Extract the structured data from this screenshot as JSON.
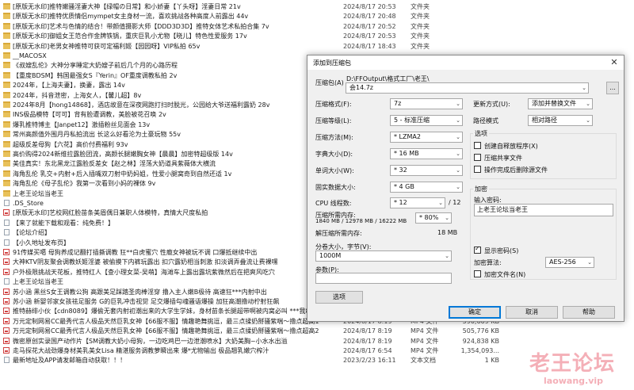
{
  "files": [
    {
      "name": "[原版无水印]推特嫩骚淫妻大神【绿帽の日常】和小娇妻【丫头呀】淫妻日常 21v",
      "date": "2024/8/17 20:53",
      "type": "文件夹",
      "size": "",
      "icon": "folder-icon"
    },
    {
      "name": "[原版无水印]推特优质情侣mympet女主身材一流，喜欢挑战各种高度人前露出 44v",
      "date": "2024/8/17 20:48",
      "type": "文件夹",
      "size": "",
      "icon": "folder-icon"
    },
    {
      "name": "[原版无水印]艺术与色情的结合！带颜值摄影大师【DDD3D3D】推特女体艺术私拍合集 7v",
      "date": "2024/8/17 20:52",
      "type": "文件夹",
      "size": "",
      "icon": "folder-icon"
    },
    {
      "name": "[原版无水印]御姐女王范合作金牌铁锅，重庆巨乳小尤物【晓儿】特色性爱服务 17v",
      "date": "2024/8/17 20:53",
      "type": "文件夹",
      "size": "",
      "icon": "folder-icon"
    },
    {
      "name": "[原版无水印]老男女神推特可获可定福利姬【园园呀】VIP私拍 65v",
      "date": "2024/8/17 18:43",
      "type": "文件夹",
      "size": "",
      "icon": "folder-icon"
    },
    {
      "name": "__MACOSX",
      "date": "",
      "type": "",
      "size": "",
      "icon": "folder-icon"
    },
    {
      "name": "《叔嫂乱伦》大神分享睡定大奶嫂子前后几个月的心路历程",
      "date": "",
      "type": "",
      "size": "",
      "icon": "folder-icon"
    },
    {
      "name": "【重度BDSM】韩国最强女S『Yerin』OF重度调教私拍 2v",
      "date": "",
      "type": "",
      "size": "",
      "icon": "folder-icon"
    },
    {
      "name": "2024年，【上海夫妻】，换妻，露出 14v",
      "date": "",
      "type": "",
      "size": "",
      "icon": "folder-icon"
    },
    {
      "name": "2024年，抖音泄密，上海女人，【馨儿超】8v",
      "date": "",
      "type": "",
      "size": "",
      "icon": "folder-icon"
    },
    {
      "name": "2024年8月【hong14868】，酒店故意在深夜网跑打扫时脱光，公园给大爷送福利露奶 28v",
      "date": "",
      "type": "",
      "size": "",
      "icon": "folder-icon"
    },
    {
      "name": "INS极品模特【可可】背有脸遭调教，美脸被花召唤 2v",
      "date": "",
      "type": "",
      "size": "",
      "icon": "folder-icon"
    },
    {
      "name": "爆乳推特博主【Janpet12】激插粉丝见面会 13v",
      "date": "",
      "type": "",
      "size": "",
      "icon": "folder-icon"
    },
    {
      "name": "常州高颜值外围月丹私拍流出 长这么好看沦为土豪玩物 55v",
      "date": "",
      "type": "",
      "size": "",
      "icon": "folder-icon"
    },
    {
      "name": "超级反差母狗【六花】高价付费福利 93v",
      "date": "",
      "type": "",
      "size": "",
      "icon": "folder-icon"
    },
    {
      "name": "高价购得2024新维拉露脸团流，高颜长腿嫩胸女神【晨晨】加密特超级版 14v",
      "date": "",
      "type": "",
      "size": "",
      "icon": "folder-icon"
    },
    {
      "name": "美佳真实！东北黑龙江露脸反差女【赵之林】淫荡大奶道具紫薇体大横流",
      "date": "",
      "type": "",
      "size": "",
      "icon": "folder-icon"
    },
    {
      "name": "海角乱伦 乳交+内射+后入插嘴双刀射中奶妈姐，性爱小腿窝奇到自然还适 1v",
      "date": "",
      "type": "",
      "size": "",
      "icon": "folder-icon"
    },
    {
      "name": "海角乱伦《母子乱伦》我第一次看到小妈的裸体 9v",
      "date": "",
      "type": "",
      "size": "",
      "icon": "folder-icon"
    },
    {
      "name": "上老王论坛当老王",
      "date": "",
      "type": "",
      "size": "",
      "icon": "folder-icon"
    },
    {
      "name": ".DS_Store",
      "date": "",
      "type": "",
      "size": "",
      "icon": "file-icon"
    },
    {
      "name": "[原版无水印]艺校网红脸苗条美眉偶日兼职人体模特，真情大尺度私拍",
      "date": "",
      "type": "",
      "size": "",
      "icon": "image-icon"
    },
    {
      "name": "【来了就能下载和观看：纯免费！】",
      "date": "",
      "type": "",
      "size": "",
      "icon": "file-icon"
    },
    {
      "name": "【论坛介绍】",
      "date": "",
      "type": "",
      "size": "",
      "icon": "file-icon"
    },
    {
      "name": "【小久地址发布页】",
      "date": "",
      "type": "",
      "size": "",
      "icon": "file-icon"
    },
    {
      "name": "91传媒买噶 母狗养成记翻打插撕调教 狂**白虎蜜穴 性瘾女神被玩不调 口爆抵继续中出",
      "date": "",
      "type": "",
      "size": "",
      "icon": "image-icon"
    },
    {
      "name": "大神KTV阴友聚会调教妖姬淫婆 被偷摸下内裤玩露出 扣穴露奶相当刺激 扣淡调弄叠流让费裸嘿",
      "date": "",
      "type": "",
      "size": "",
      "icon": "image-icon"
    },
    {
      "name": "户外极限挑战天花板，推特红人【查小理女菜-吴萌】海滩车上露出露坑紫微然后在把爽风吃穴",
      "date": "",
      "type": "",
      "size": "",
      "icon": "image-icon"
    },
    {
      "name": "上老王论坛当老王",
      "date": "",
      "type": "",
      "size": "",
      "icon": "file-icon"
    },
    {
      "name": "苏小涵 黑丝S女王调教公狗 高跟美足踩踏圣肉棒淫穿 撸入主人嫩B极待 高速狂***内射中出",
      "date": "",
      "type": "",
      "size": "",
      "icon": "image-icon"
    },
    {
      "name": "苏小涵 新婴邻家女孩祛足服务 G的巨乳冲击视觉 足交爆插勾魂骚语爆操 加狂高潮撸动柠射狂飙",
      "date": "",
      "type": "",
      "size": "",
      "icon": "image-icon"
    },
    {
      "name": "推特赫绯小伙【cdn8089】爆偷无套内射初潮出来的大学生学妹，身材苗条长腿超带啊被内窝必叫 ***我8v不得",
      "date": "",
      "type": "",
      "size": "",
      "icon": "image-icon"
    },
    {
      "name": "万元定制网易CC最秀代言人极品天然巨乳女神【66服不服】情趣艳舞挑逗，最三点揉奶掰骚紫喘～撸点超高1",
      "date": "2024/8/17 8:19",
      "type": "MP4 文件",
      "size": "590,669 KB",
      "icon": "image-icon"
    },
    {
      "name": "万元定制网易CC最秀代言人极品天然巨乳女神【66服不服】情趣艳舞挑逗，最三点揉奶掰骚紫喘～撸点超高2",
      "date": "2024/8/17 8:19",
      "type": "MP4 文件",
      "size": "505,776 KB",
      "icon": "image-icon"
    },
    {
      "name": "微密原创实录国产动作片【SM调教大奶小母狗，一边吃鸡巴一边泄潮喷水】大奶美胸~小水水出溢",
      "date": "2024/8/17 8:19",
      "type": "MP4 文件",
      "size": "924,838 KB",
      "icon": "image-icon"
    },
    {
      "name": "走马探花大战劲爆身材美乳美女Lisa 精湛服务调教萝瞬出来 爆*尤物输出 极品翘乳嫩穴榨汁",
      "date": "2024/8/17 6:54",
      "type": "MP4 文件",
      "size": "1,354,093...",
      "icon": "image-icon"
    },
    {
      "name": "最新地址及APP请发邮箱自动获取！！！",
      "date": "2023/2/23 16:11",
      "type": "文本文档",
      "size": "1 KB",
      "icon": "file-icon"
    }
  ],
  "dialog": {
    "title": "添加到压缩包",
    "close_glyph": "✕",
    "archive_label": "压缩包(A)",
    "archive_path": "D:\\FFOutput\\格式工厂\\老王\\",
    "archive_name": "会14.7z",
    "browse_label": "...",
    "format_label": "压缩格式(F):",
    "format_value": "7z",
    "level_label": "压缩等级(L):",
    "level_value": "5 - 标准压缩",
    "method_label": "压缩方法(M):",
    "method_value": "* LZMA2",
    "dict_label": "字典大小(D):",
    "dict_value": "* 16 MB",
    "word_label": "单词大小(W):",
    "word_value": "* 32",
    "solid_label": "固实数据大小:",
    "solid_value": "* 4 GB",
    "threads_label": "CPU 线程数:",
    "threads_value": "* 12",
    "threads_total": "/ 12",
    "mem_label": "压缩所需内存:",
    "mem_value": "1840 MB / 12978 MB / 16222 MB",
    "mem_percent": "* 80%",
    "decomp_label": "解压缩所需内存:",
    "decomp_value": "18 MB",
    "split_label": "分卷大小，字节(V):",
    "split_value": "1000M",
    "params_label": "参数(P):",
    "params_value": "",
    "options_button": "选项",
    "update_label": "更新方式(U):",
    "update_value": "添加并替换文件",
    "pathmode_label": "路径模式",
    "pathmode_value": "相对路径",
    "options_group": "选项",
    "opt_sfx": "创建自释放程序(X)",
    "opt_shared": "压缩共享文件",
    "opt_delete": "操作完成后删除源文件",
    "encrypt_group": "加密",
    "pwd_label": "输入密码:",
    "pwd_value": "上老王论坛当老王",
    "show_pwd": "显示密码(S)",
    "enc_method_label": "加密算法:",
    "enc_method_value": "AES-256",
    "enc_names": "加密文件名(N)",
    "ok_button": "确定",
    "cancel_button": "取消",
    "help_button": "帮助",
    "checks": {
      "sfx": false,
      "shared": false,
      "delete": false,
      "show_pwd": true,
      "enc_names": false
    }
  },
  "watermark": {
    "main": "老王论坛",
    "sub": "laowang.vip"
  }
}
